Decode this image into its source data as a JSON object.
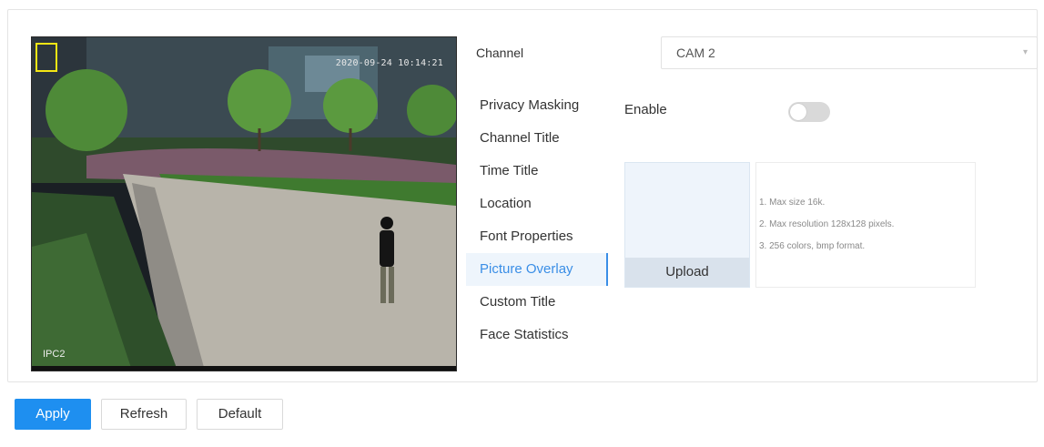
{
  "video": {
    "timestamp": "2020-09-24 10:14:21",
    "osd_label": "IPC2"
  },
  "channel": {
    "label": "Channel",
    "value": "CAM 2"
  },
  "menu": {
    "items": [
      {
        "label": "Privacy Masking",
        "active": false
      },
      {
        "label": "Channel Title",
        "active": false
      },
      {
        "label": "Time Title",
        "active": false
      },
      {
        "label": "Location",
        "active": false
      },
      {
        "label": "Font Properties",
        "active": false
      },
      {
        "label": "Picture Overlay",
        "active": true
      },
      {
        "label": "Custom Title",
        "active": false
      },
      {
        "label": "Face Statistics",
        "active": false
      }
    ]
  },
  "overlay": {
    "enable_label": "Enable",
    "enabled": false,
    "upload_label": "Upload",
    "hints": [
      "1. Max size 16k.",
      "2. Max resolution 128x128 pixels.",
      "3. 256 colors, bmp format."
    ]
  },
  "actions": {
    "apply": "Apply",
    "refresh": "Refresh",
    "default": "Default"
  },
  "colors": {
    "accent": "#1e8ff0",
    "active_menu_text": "#3a8ee6",
    "active_menu_bg": "#eef5fc",
    "overlay_box": "#f5e614"
  }
}
